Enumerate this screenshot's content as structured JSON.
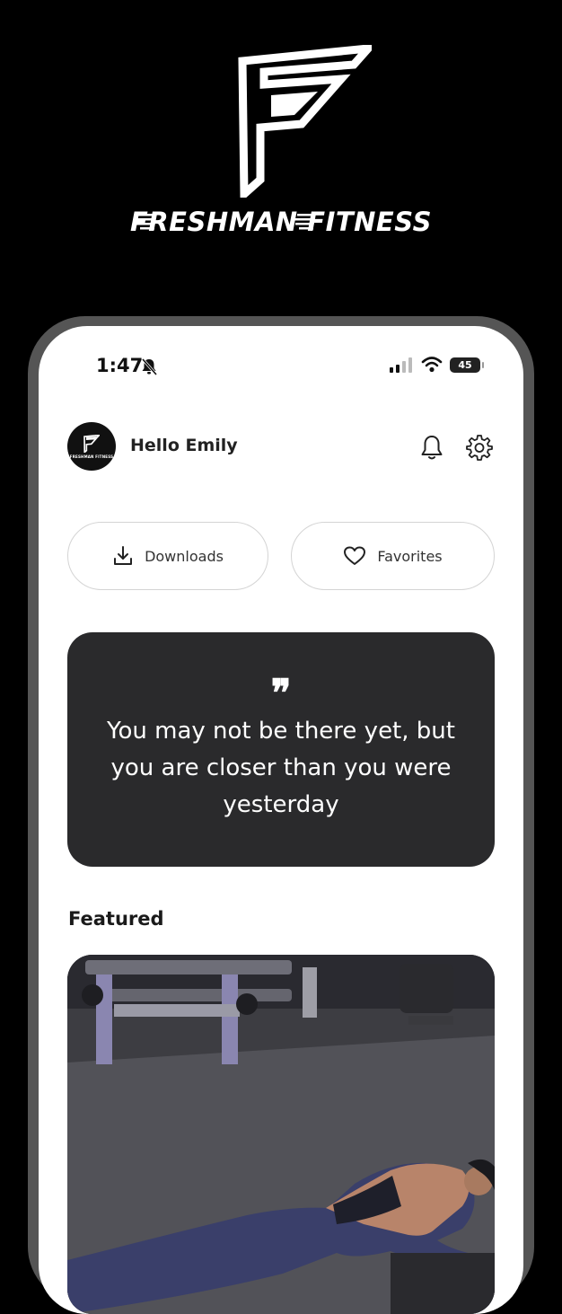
{
  "brand": {
    "name": "FRESHMAN FITNESS"
  },
  "status_bar": {
    "time": "1:47",
    "battery": "45",
    "icons": [
      "bell-slash-icon",
      "signal-icon",
      "wifi-icon",
      "battery-icon"
    ]
  },
  "header": {
    "greeting": "Hello Emily",
    "avatar_caption": "FRESHMAN FITNESS",
    "icons": [
      "bell-icon",
      "gear-icon"
    ]
  },
  "quick_actions": [
    {
      "label": "Downloads",
      "icon": "download-icon"
    },
    {
      "label": "Favorites",
      "icon": "heart-icon"
    }
  ],
  "quote": {
    "mark": "❞",
    "text": "You may not be there yet, but you are closer than you were yesterday"
  },
  "featured": {
    "title": "Featured"
  },
  "colors": {
    "background": "#000000",
    "screen": "#ffffff",
    "card": "#2a2a2c",
    "pill_border": "#d4d4d4"
  }
}
